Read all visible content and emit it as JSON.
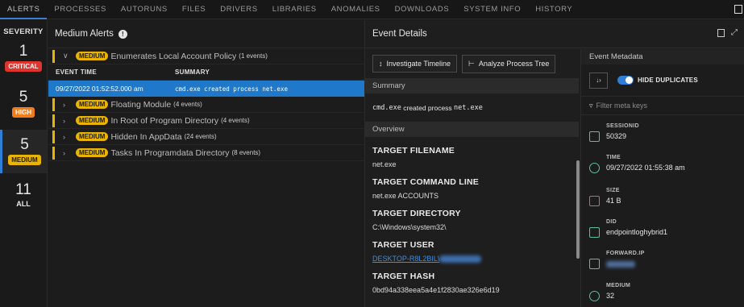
{
  "nav": {
    "tabs": [
      "ALERTS",
      "PROCESSES",
      "AUTORUNS",
      "FILES",
      "DRIVERS",
      "LIBRARIES",
      "ANOMALIES",
      "DOWNLOADS",
      "SYSTEM INFO",
      "HISTORY"
    ],
    "active_tab": "ALERTS"
  },
  "severity": {
    "title": "SEVERITY",
    "levels": [
      {
        "count": "1",
        "label": "CRITICAL",
        "color": "#e0342f",
        "text_color": "#ffffff"
      },
      {
        "count": "5",
        "label": "HIGH",
        "color": "#f07d1a",
        "text_color": "#ffffff"
      },
      {
        "count": "5",
        "label": "MEDIUM",
        "color": "#e8b400",
        "text_color": "#1a1a1a"
      },
      {
        "count": "11",
        "label": "ALL"
      }
    ],
    "selected": "MEDIUM"
  },
  "alerts": {
    "header": "Medium Alerts",
    "groups": [
      {
        "severity": "MEDIUM",
        "name": "Enumerates Local Account Policy",
        "count": "(1 events)",
        "expanded": true
      },
      {
        "severity": "MEDIUM",
        "name": "Floating Module",
        "count": "(4 events)"
      },
      {
        "severity": "MEDIUM",
        "name": "In Root of Program Directory",
        "count": "(4 events)"
      },
      {
        "severity": "MEDIUM",
        "name": "Hidden In AppData",
        "count": "(24 events)"
      },
      {
        "severity": "MEDIUM",
        "name": "Tasks In Programdata Directory",
        "count": "(8 events)"
      }
    ],
    "columns": [
      "EVENT TIME",
      "SUMMARY"
    ],
    "event": {
      "time": "09/27/2022 01:52:52.000 am",
      "summary": "cmd.exe created process net.exe"
    }
  },
  "details": {
    "title": "Event Details",
    "buttons": {
      "timeline": "Investigate Timeline",
      "tree": "Analyze Process Tree"
    },
    "summary_label": "Summary",
    "summary_prefix": "cmd.exe",
    "summary_middle": " created process ",
    "summary_suffix": "net.exe",
    "overview_label": "Overview",
    "fields": [
      {
        "label": "TARGET FILENAME",
        "value": "net.exe"
      },
      {
        "label": "TARGET COMMAND LINE",
        "value": "net.exe ACCOUNTS"
      },
      {
        "label": "TARGET DIRECTORY",
        "value": "C:\\Windows\\system32\\"
      },
      {
        "label": "TARGET USER",
        "value": "DESKTOP-R8L2BIL\\"
      },
      {
        "label": "TARGET HASH",
        "value": "0bd94a338eea5a4e1f2830ae326e6d19"
      }
    ]
  },
  "metadata": {
    "title": "Event Metadata",
    "hide_duplicates": "HIDE DUPLICATES",
    "filter_placeholder": "Filter meta keys",
    "items": [
      {
        "key": "SESSIONID",
        "value": "50329"
      },
      {
        "key": "TIME",
        "value": "09/27/2022 01:55:38 am"
      },
      {
        "key": "SIZE",
        "value": "41 B"
      },
      {
        "key": "DID",
        "value": "endpointloghybrid1"
      },
      {
        "key": "FORWARD.IP",
        "value": ""
      },
      {
        "key": "MEDIUM",
        "value": "32"
      }
    ]
  }
}
